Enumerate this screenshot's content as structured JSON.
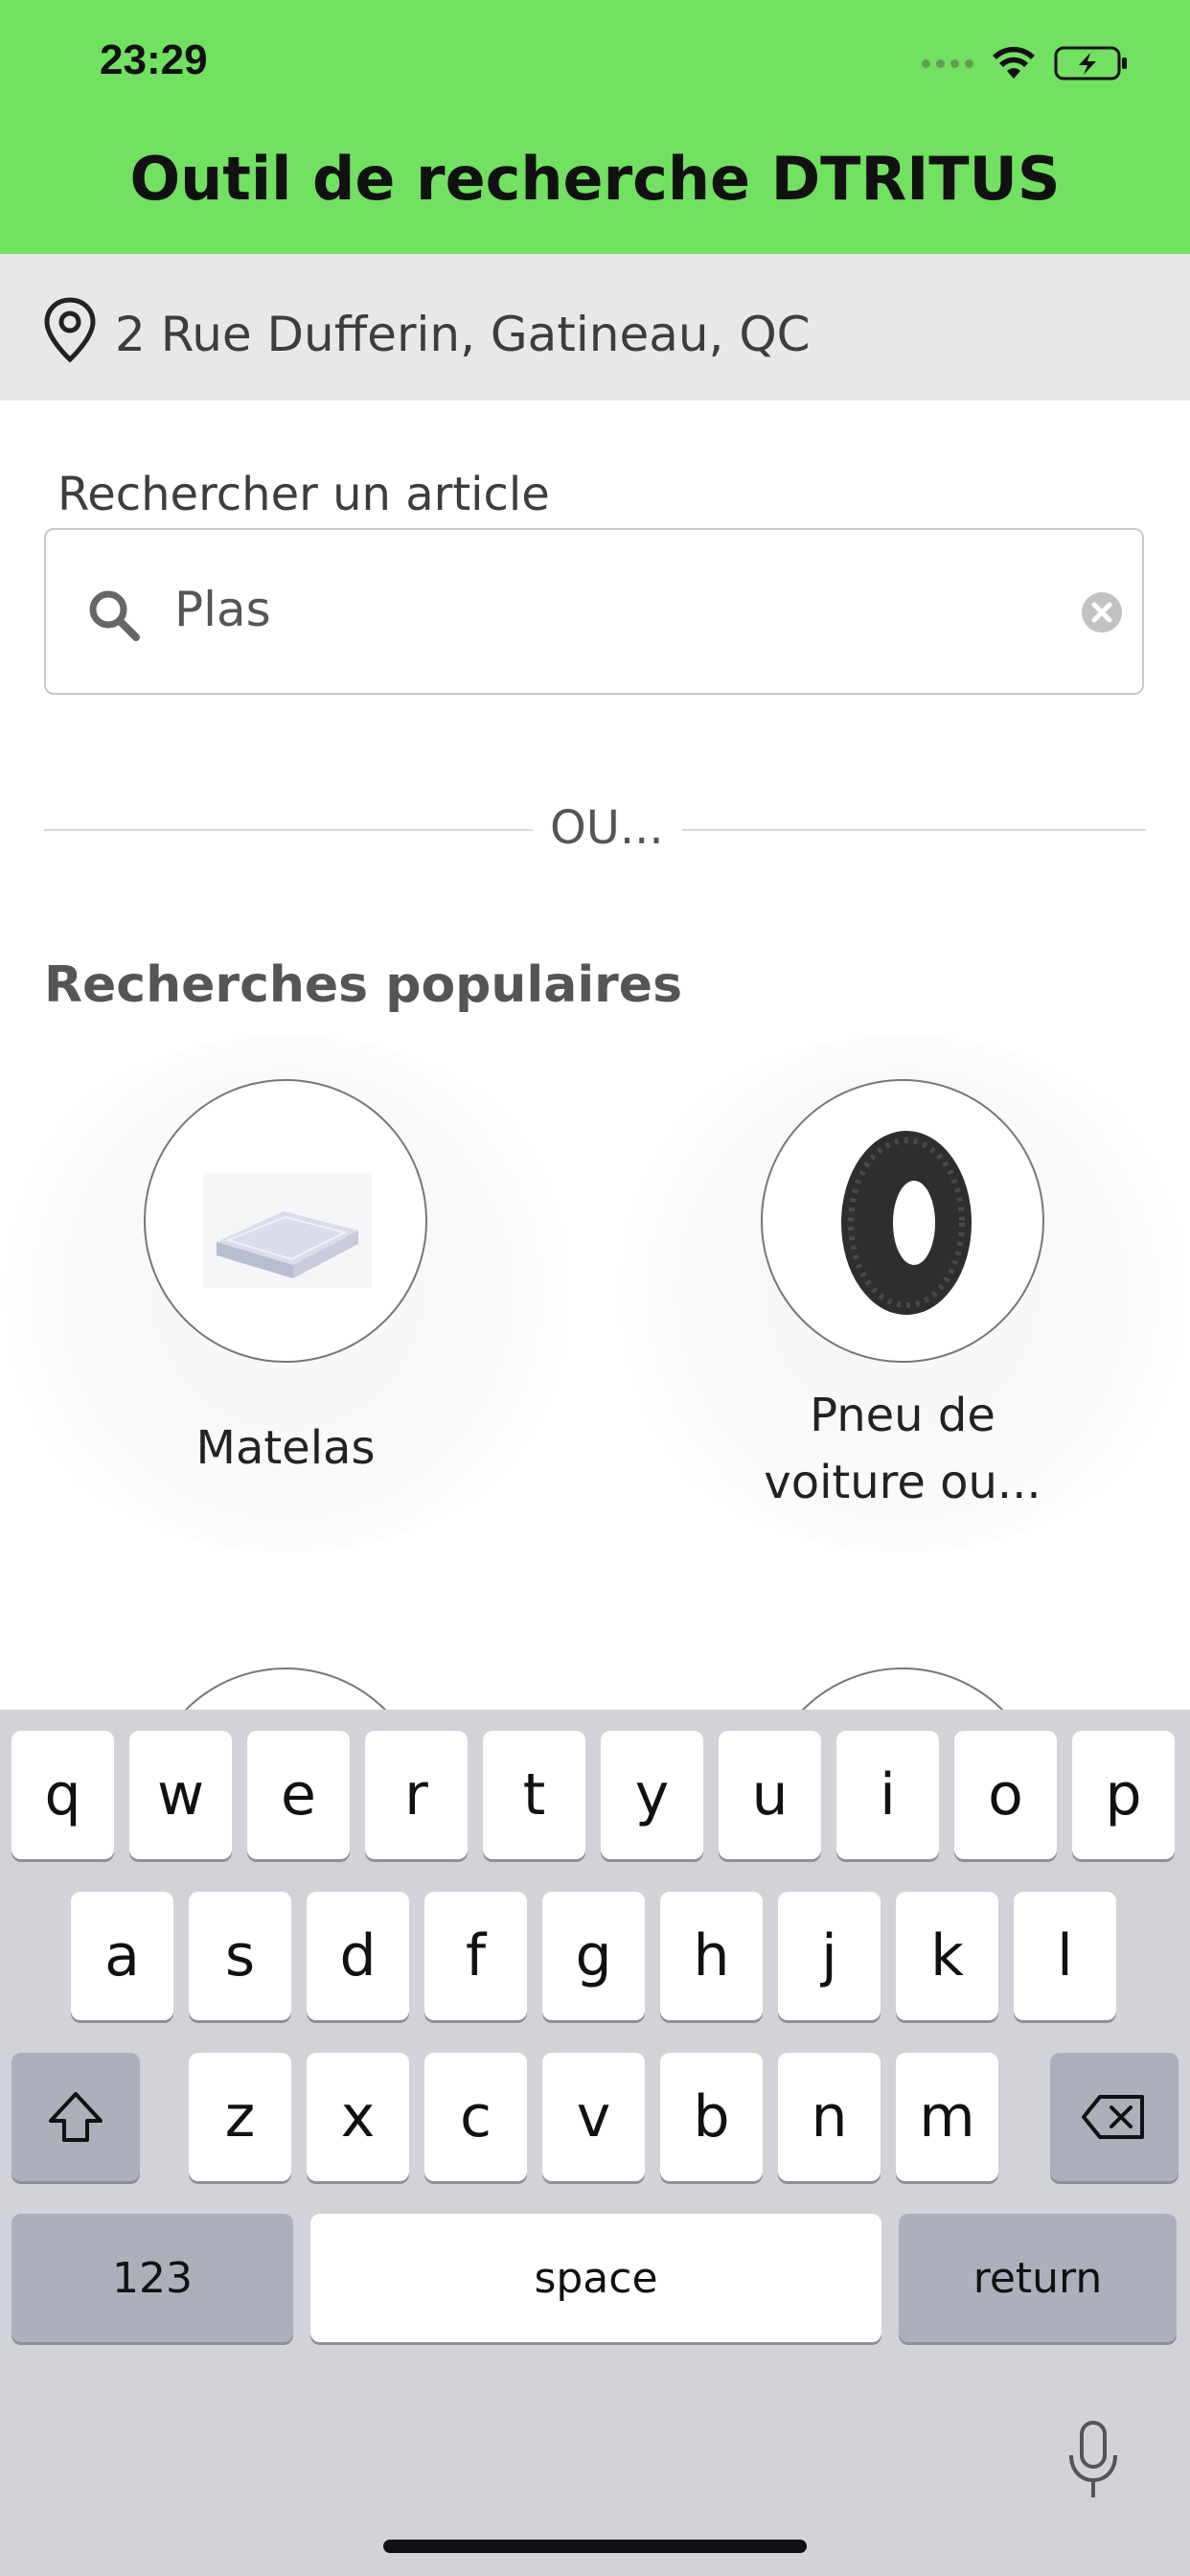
{
  "status_bar": {
    "time": "23:29"
  },
  "header": {
    "title": "Outil de recherche DTRITUS",
    "accent": "#72e061"
  },
  "location": {
    "address": "2 Rue Dufferin, Gatineau, QC"
  },
  "search": {
    "label": "Rechercher un article",
    "value": "Plas"
  },
  "divider": {
    "text": "OU..."
  },
  "popular": {
    "title": "Recherches populaires",
    "items": [
      {
        "label": "Matelas",
        "icon": "mattress-image"
      },
      {
        "label_line1": "Pneu de",
        "label_line2": "voiture ou...",
        "icon": "tire-image"
      }
    ]
  },
  "keyboard": {
    "row1": [
      "q",
      "w",
      "e",
      "r",
      "t",
      "y",
      "u",
      "i",
      "o",
      "p"
    ],
    "row2": [
      "a",
      "s",
      "d",
      "f",
      "g",
      "h",
      "j",
      "k",
      "l"
    ],
    "row3": [
      "z",
      "x",
      "c",
      "v",
      "b",
      "n",
      "m"
    ],
    "numbers": "123",
    "space": "space",
    "return": "return"
  }
}
